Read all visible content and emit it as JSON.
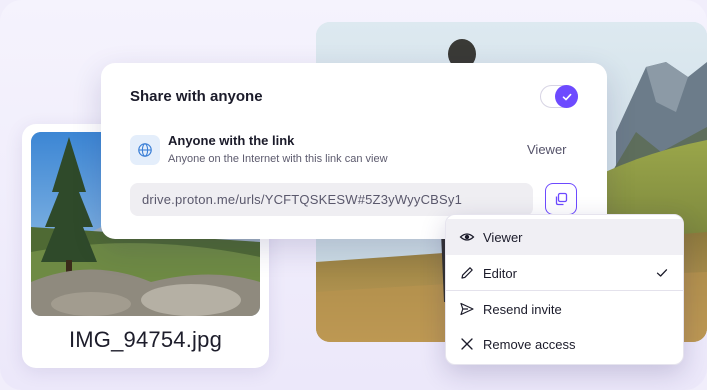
{
  "share_dialog": {
    "title": "Share with anyone",
    "toggle_on": true,
    "link_title": "Anyone with the link",
    "link_subtitle": "Anyone on the Internet with this link can view",
    "role": "Viewer",
    "url": "drive.proton.me/urls/YCFTQSKESW#5Z3yWyyCBSy1"
  },
  "file": {
    "name": "IMG_94754.jpg"
  },
  "menu": {
    "items": [
      {
        "label": "Viewer",
        "icon": "eye-icon",
        "hovered": true,
        "checked": false
      },
      {
        "label": "Editor",
        "icon": "pencil-icon",
        "hovered": false,
        "checked": true
      },
      {
        "label": "Resend invite",
        "icon": "send-icon",
        "hovered": false,
        "checked": false
      },
      {
        "label": "Remove access",
        "icon": "close-icon",
        "hovered": false,
        "checked": false
      }
    ]
  },
  "colors": {
    "accent": "#6d4aff",
    "background": "#f1eefb",
    "menu_hover": "#f0eff4"
  }
}
